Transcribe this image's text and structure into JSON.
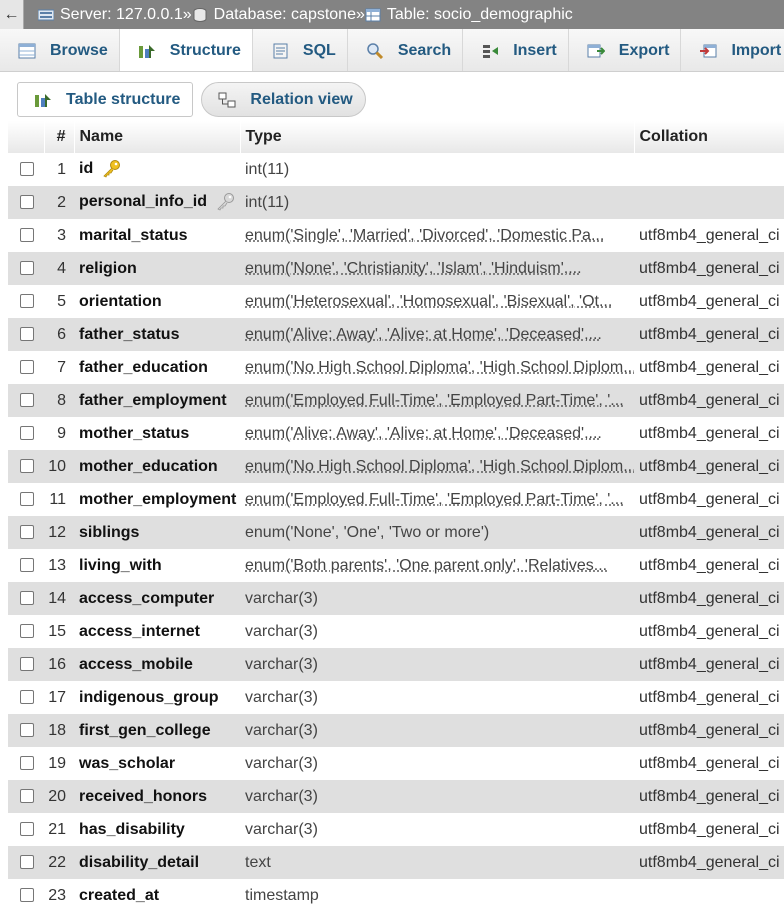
{
  "breadcrumb": {
    "back": "←",
    "server": "Server: 127.0.0.1",
    "database": "Database: capstone",
    "table": "Table: socio_demographic",
    "separator": "»"
  },
  "tabs": [
    {
      "label": "Browse",
      "icon": "browse-icon"
    },
    {
      "label": "Structure",
      "icon": "structure-icon",
      "active": true
    },
    {
      "label": "SQL",
      "icon": "sql-icon"
    },
    {
      "label": "Search",
      "icon": "search-icon"
    },
    {
      "label": "Insert",
      "icon": "insert-icon"
    },
    {
      "label": "Export",
      "icon": "export-icon"
    },
    {
      "label": "Import",
      "icon": "import-icon"
    }
  ],
  "subviews": {
    "table_structure": "Table structure",
    "relation_view": "Relation view"
  },
  "columns": {
    "num": "#",
    "name": "Name",
    "type": "Type",
    "collation": "Collation"
  },
  "rows": [
    {
      "num": "1",
      "name": "id",
      "type": "int(11)",
      "collation": "",
      "key": "primary"
    },
    {
      "num": "2",
      "name": "personal_info_id",
      "type": "int(11)",
      "collation": "",
      "key": "foreign"
    },
    {
      "num": "3",
      "name": "marital_status",
      "type": "enum('Single', 'Married', 'Divorced', 'Domestic Pa...",
      "collation": "utf8mb4_general_ci",
      "enum": true
    },
    {
      "num": "4",
      "name": "religion",
      "type": "enum('None', 'Christianity', 'Islam', 'Hinduism',...",
      "collation": "utf8mb4_general_ci",
      "enum": true
    },
    {
      "num": "5",
      "name": "orientation",
      "type": "enum('Heterosexual', 'Homosexual', 'Bisexual', 'Ot...",
      "collation": "utf8mb4_general_ci",
      "enum": true
    },
    {
      "num": "6",
      "name": "father_status",
      "type": "enum('Alive; Away', 'Alive; at Home', 'Deceased',...",
      "collation": "utf8mb4_general_ci",
      "enum": true
    },
    {
      "num": "7",
      "name": "father_education",
      "type": "enum('No High School Diploma', 'High School Diplom...",
      "collation": "utf8mb4_general_ci",
      "enum": true
    },
    {
      "num": "8",
      "name": "father_employment",
      "type": "enum('Employed Full-Time', 'Employed Part-Time', '...",
      "collation": "utf8mb4_general_ci",
      "enum": true
    },
    {
      "num": "9",
      "name": "mother_status",
      "type": "enum('Alive; Away', 'Alive; at Home', 'Deceased',...",
      "collation": "utf8mb4_general_ci",
      "enum": true
    },
    {
      "num": "10",
      "name": "mother_education",
      "type": "enum('No High School Diploma', 'High School Diplom...",
      "collation": "utf8mb4_general_ci",
      "enum": true
    },
    {
      "num": "11",
      "name": "mother_employment",
      "type": "enum('Employed Full-Time', 'Employed Part-Time', '...",
      "collation": "utf8mb4_general_ci",
      "enum": true
    },
    {
      "num": "12",
      "name": "siblings",
      "type": "enum('None', 'One', 'Two or more')",
      "collation": "utf8mb4_general_ci"
    },
    {
      "num": "13",
      "name": "living_with",
      "type": "enum('Both parents', 'One parent only', 'Relatives...",
      "collation": "utf8mb4_general_ci",
      "enum": true
    },
    {
      "num": "14",
      "name": "access_computer",
      "type": "varchar(3)",
      "collation": "utf8mb4_general_ci"
    },
    {
      "num": "15",
      "name": "access_internet",
      "type": "varchar(3)",
      "collation": "utf8mb4_general_ci"
    },
    {
      "num": "16",
      "name": "access_mobile",
      "type": "varchar(3)",
      "collation": "utf8mb4_general_ci"
    },
    {
      "num": "17",
      "name": "indigenous_group",
      "type": "varchar(3)",
      "collation": "utf8mb4_general_ci"
    },
    {
      "num": "18",
      "name": "first_gen_college",
      "type": "varchar(3)",
      "collation": "utf8mb4_general_ci"
    },
    {
      "num": "19",
      "name": "was_scholar",
      "type": "varchar(3)",
      "collation": "utf8mb4_general_ci"
    },
    {
      "num": "20",
      "name": "received_honors",
      "type": "varchar(3)",
      "collation": "utf8mb4_general_ci"
    },
    {
      "num": "21",
      "name": "has_disability",
      "type": "varchar(3)",
      "collation": "utf8mb4_general_ci"
    },
    {
      "num": "22",
      "name": "disability_detail",
      "type": "text",
      "collation": "utf8mb4_general_ci"
    },
    {
      "num": "23",
      "name": "created_at",
      "type": "timestamp",
      "collation": ""
    }
  ]
}
